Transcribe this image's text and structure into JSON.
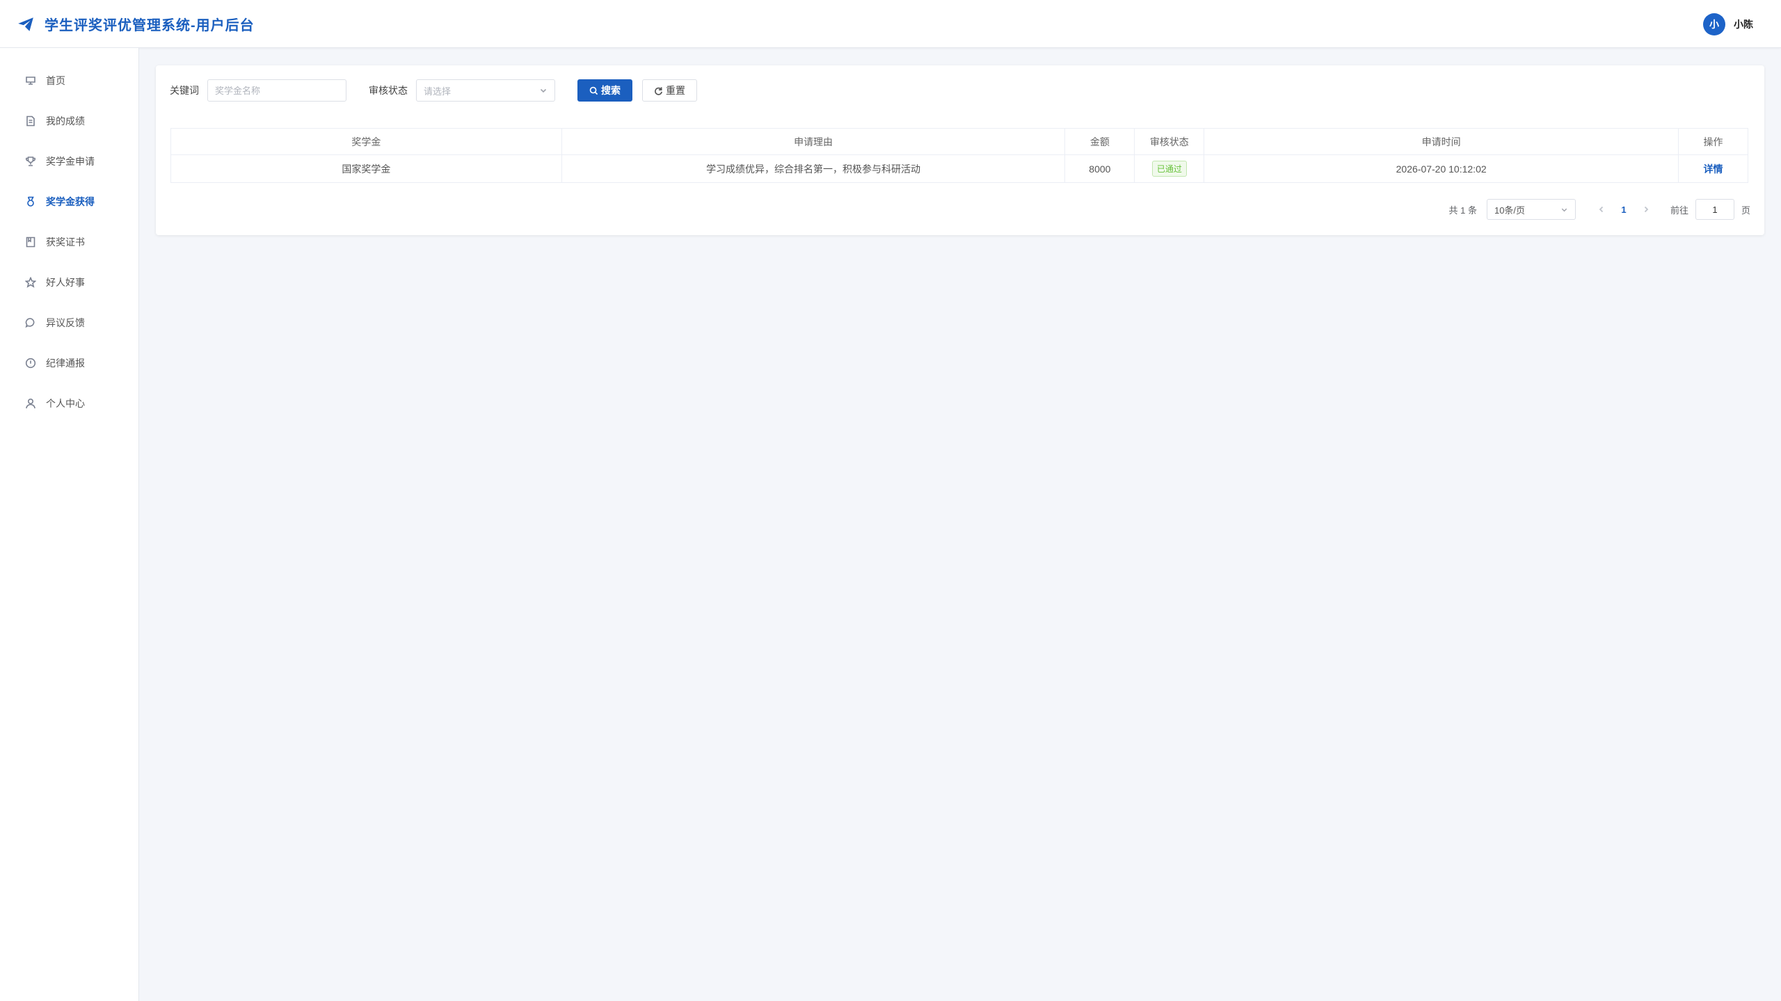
{
  "header": {
    "title": "学生评奖评优管理系统-用户后台",
    "logo_icon": "paper-plane-icon",
    "brand_color": "#1b5fbf",
    "user": {
      "avatar_text": "小",
      "name": "小陈"
    }
  },
  "sidebar": {
    "items": [
      {
        "label": "首页",
        "icon": "home-icon",
        "active": false
      },
      {
        "label": "我的成绩",
        "icon": "document-icon",
        "active": false
      },
      {
        "label": "奖学金申请",
        "icon": "trophy-icon",
        "active": false
      },
      {
        "label": "奖学金获得",
        "icon": "medal-icon",
        "active": true
      },
      {
        "label": "获奖证书",
        "icon": "certificate-icon",
        "active": false
      },
      {
        "label": "好人好事",
        "icon": "star-icon",
        "active": false
      },
      {
        "label": "异议反馈",
        "icon": "chat-icon",
        "active": false
      },
      {
        "label": "纪律通报",
        "icon": "alert-icon",
        "active": false
      },
      {
        "label": "个人中心",
        "icon": "user-icon",
        "active": false
      }
    ]
  },
  "filter": {
    "keyword_label": "关键词",
    "keyword_placeholder": "奖学金名称",
    "keyword_value": "",
    "status_label": "审核状态",
    "status_placeholder": "请选择",
    "search_label": "搜索",
    "reset_label": "重置"
  },
  "table": {
    "columns": [
      "奖学金",
      "申请理由",
      "金额",
      "审核状态",
      "申请时间",
      "操作"
    ],
    "rows": [
      {
        "scholarship": "国家奖学金",
        "reason": "学习成绩优异，综合排名第一，积极参与科研活动",
        "amount": "8000",
        "status": "已通过",
        "time": "2026-07-20 10:12:02",
        "action": "详情"
      }
    ]
  },
  "pagination": {
    "total_text": "共 1 条",
    "page_size": "10条/页",
    "current_page": "1",
    "goto_label": "前往",
    "goto_value": "1",
    "page_suffix": "页"
  }
}
